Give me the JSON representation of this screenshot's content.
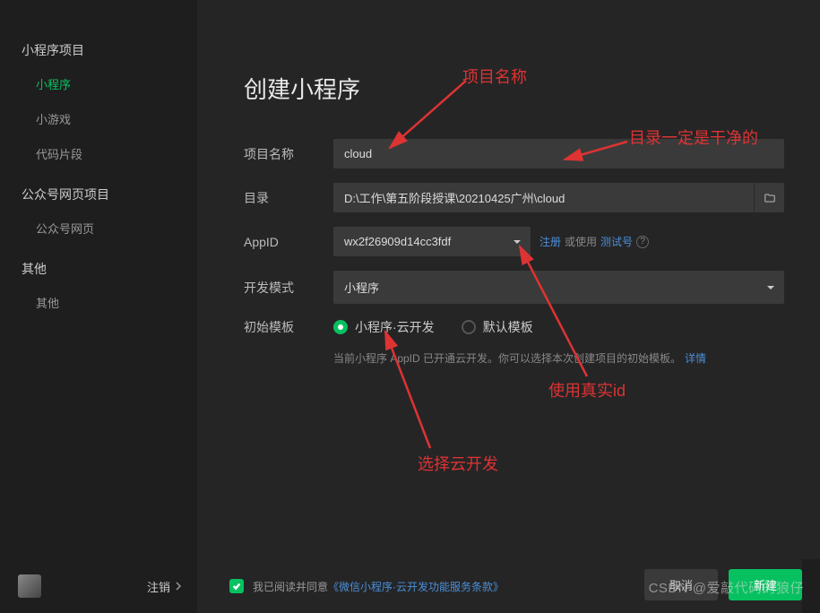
{
  "window": {
    "settings_icon": "settings",
    "close_icon": "close"
  },
  "sidebar": {
    "groups": [
      {
        "title": "小程序项目",
        "items": [
          {
            "label": "小程序",
            "active": true
          },
          {
            "label": "小游戏",
            "active": false
          },
          {
            "label": "代码片段",
            "active": false
          }
        ]
      },
      {
        "title": "公众号网页项目",
        "items": [
          {
            "label": "公众号网页",
            "active": false
          }
        ]
      },
      {
        "title": "其他",
        "items": [
          {
            "label": "其他",
            "active": false
          }
        ]
      }
    ]
  },
  "main": {
    "title": "创建小程序",
    "labels": {
      "project_name": "项目名称",
      "directory": "目录",
      "appid": "AppID",
      "dev_mode": "开发模式",
      "init_template": "初始模板"
    },
    "values": {
      "project_name": "cloud",
      "directory": "D:\\工作\\第五阶段授课\\20210425广州\\cloud",
      "appid": "wx2f26909d14cc3fdf",
      "dev_mode": "小程序"
    },
    "appid_side": {
      "register": "注册",
      "or_use": "或使用",
      "test_account": "测试号"
    },
    "template_options": [
      {
        "label": "小程序·云开发",
        "checked": true
      },
      {
        "label": "默认模板",
        "checked": false
      }
    ],
    "template_note": "当前小程序 AppID 已开通云开发。你可以选择本次创建项目的初始模板。",
    "template_note_link": "详情"
  },
  "footer": {
    "logout": "注销",
    "agree_prefix": "我已阅读并同意",
    "agree_link": "《微信小程序·云开发功能服务条款》",
    "btn_cancel": "取消",
    "btn_confirm": "新建"
  },
  "annotations": {
    "a1": "项目名称",
    "a2": "目录一定是干净的",
    "a3": "使用真实id",
    "a4": "选择云开发"
  },
  "watermark": "CSDN @爱敲代码的狼仔"
}
